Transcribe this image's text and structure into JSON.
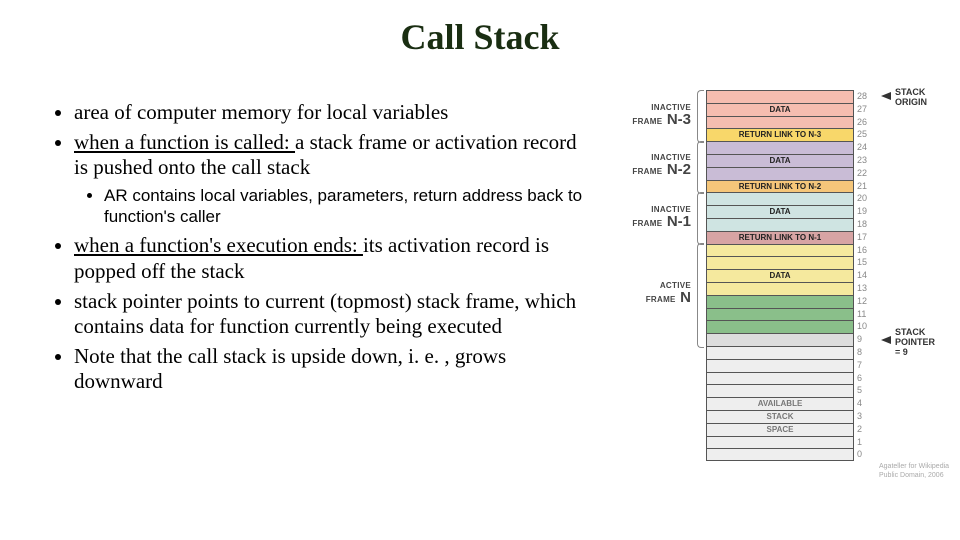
{
  "title": "Call Stack",
  "bullets": {
    "b1": "area of computer memory for local variables",
    "b2a": "when a function is called: ",
    "b2b": "a stack frame or activation record is pushed onto the call stack",
    "b2s": "AR contains local variables, parameters, return address back to function's caller",
    "b3a": "when a function's execution ends: ",
    "b3b": "its activation record is popped off the stack",
    "b4": "stack pointer points to current (topmost) stack frame, which contains data for function currently being executed",
    "b5": "Note that the call stack is upside down, i. e. , grows downward"
  },
  "diagram": {
    "rows": [
      {
        "label": "",
        "class": "data-red"
      },
      {
        "label": "DATA",
        "class": "data-red"
      },
      {
        "label": "",
        "class": "data-red"
      },
      {
        "label": "RETURN LINK TO N-3",
        "class": "ret-n3"
      },
      {
        "label": "",
        "class": "data-purple"
      },
      {
        "label": "DATA",
        "class": "data-purple"
      },
      {
        "label": "",
        "class": "data-purple"
      },
      {
        "label": "RETURN LINK TO N-2",
        "class": "ret-n2"
      },
      {
        "label": "",
        "class": "data-blue"
      },
      {
        "label": "DATA",
        "class": "data-blue"
      },
      {
        "label": "",
        "class": "data-blue"
      },
      {
        "label": "RETURN LINK TO N-1",
        "class": "ret-n1"
      },
      {
        "label": "",
        "class": "data-yellow"
      },
      {
        "label": "",
        "class": "data-yellow"
      },
      {
        "label": "DATA",
        "class": "data-yellow"
      },
      {
        "label": "",
        "class": "data-yellow"
      },
      {
        "label": "",
        "class": "data-green"
      },
      {
        "label": "",
        "class": "data-green"
      },
      {
        "label": "",
        "class": "data-green"
      },
      {
        "label": "",
        "class": "sp"
      },
      {
        "label": "",
        "class": "avail"
      },
      {
        "label": "",
        "class": "avail"
      },
      {
        "label": "",
        "class": "avail"
      },
      {
        "label": "",
        "class": "avail"
      },
      {
        "label": "AVAILABLE",
        "class": "avail"
      },
      {
        "label": "STACK",
        "class": "avail"
      },
      {
        "label": "SPACE",
        "class": "avail"
      },
      {
        "label": "",
        "class": "avail"
      },
      {
        "label": "",
        "class": "avail last"
      }
    ],
    "indices": [
      "28",
      "27",
      "26",
      "25",
      "24",
      "23",
      "22",
      "21",
      "20",
      "19",
      "18",
      "17",
      "16",
      "15",
      "14",
      "13",
      "12",
      "11",
      "10",
      "9",
      "8",
      "7",
      "6",
      "5",
      "4",
      "3",
      "2",
      "1",
      "0"
    ],
    "frames": [
      {
        "l1": "INACTIVE",
        "l2": "FRAME",
        "n": "N-3"
      },
      {
        "l1": "INACTIVE",
        "l2": "FRAME",
        "n": "N-2"
      },
      {
        "l1": "INACTIVE",
        "l2": "FRAME",
        "n": "N-1"
      },
      {
        "l1": "ACTIVE",
        "l2": "FRAME",
        "n": "N"
      }
    ],
    "annot_origin": "STACK\nORIGIN",
    "annot_sp": "STACK\nPOINTER\n= 9",
    "credit1": "Agateller for Wikipedia",
    "credit2": "Public Domain, 2006"
  }
}
